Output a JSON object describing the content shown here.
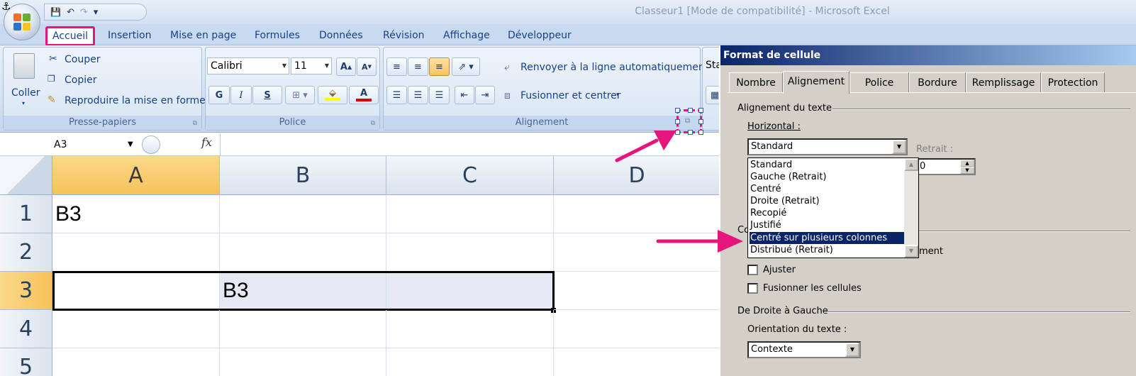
{
  "window": {
    "title": "Classeur1  [Mode de compatibilité] - Microsoft Excel"
  },
  "qat": {
    "save_icon": "💾",
    "undo_icon": "↶",
    "redo_icon": "↷",
    "more_icon": "▾"
  },
  "tabs": [
    "Accueil",
    "Insertion",
    "Mise en page",
    "Formules",
    "Données",
    "Révision",
    "Affichage",
    "Développeur"
  ],
  "ribbon": {
    "clipboard": {
      "paste": "Coller",
      "cut": "Couper",
      "copy": "Copier",
      "format_painter": "Reproduire la mise en forme",
      "label": "Presse-papiers"
    },
    "font": {
      "name": "Calibri",
      "size": "11",
      "bold": "G",
      "italic": "I",
      "underline": "S",
      "label": "Police"
    },
    "alignment": {
      "wrap": "Renvoyer à la ligne automatiquement",
      "merge": "Fusionner et centrer",
      "label": "Alignement"
    },
    "next_partial": "Sta"
  },
  "formula_bar": {
    "cell_ref": "A3",
    "fx": "fx",
    "value": ""
  },
  "sheet": {
    "columns": [
      "A",
      "B",
      "C",
      "D"
    ],
    "rows": [
      "1",
      "2",
      "3",
      "4",
      "5"
    ],
    "selected_col": "A",
    "selected_row": "3",
    "cells": {
      "A1": "B3",
      "B3": "B3"
    }
  },
  "dialog": {
    "title": "Format de cellule",
    "tabs": [
      "Nombre",
      "Alignement",
      "Police",
      "Bordure",
      "Remplissage",
      "Protection"
    ],
    "active_tab": "Alignement",
    "section_text_alignment": "Alignement du texte",
    "horizontal_label": "Horizontal :",
    "horizontal_value": "Standard",
    "indent_label": "Retrait :",
    "indent_value": "0",
    "horizontal_options": [
      "Standard",
      "Gauche (Retrait)",
      "Centré",
      "Droite (Retrait)",
      "Recopié",
      "Justifié",
      "Centré sur plusieurs colonnes",
      "Distribué (Retrait)"
    ],
    "selected_option": "Centré sur plusieurs colonnes",
    "section_control_partial": "Co",
    "wrap_partial": "ment",
    "shrink_label": "Ajuster",
    "merge_cells_label": "Fusionner les cellules",
    "section_rtl": "De Droite à Gauche",
    "orientation_label": "Orientation du texte :",
    "orientation_value": "Contexte"
  },
  "colors": {
    "highlight": "#e6157b",
    "selection": "#0a246a",
    "title_gradient_start": "#0a246a",
    "column_selected": "#f6c15a"
  }
}
